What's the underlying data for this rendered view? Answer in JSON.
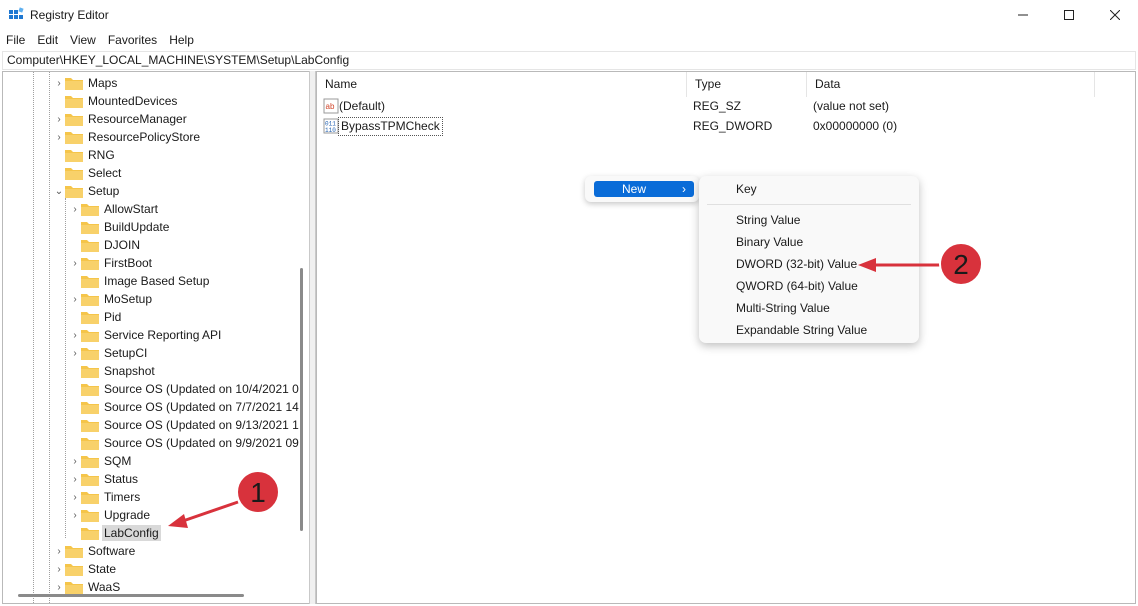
{
  "window": {
    "title": "Registry Editor"
  },
  "menu": [
    "File",
    "Edit",
    "View",
    "Favorites",
    "Help"
  ],
  "address": "Computer\\HKEY_LOCAL_MACHINE\\SYSTEM\\Setup\\LabConfig",
  "tree": {
    "items": [
      "Maps",
      "MountedDevices",
      "ResourceManager",
      "ResourcePolicyStore",
      "RNG",
      "Select",
      "Setup",
      "AllowStart",
      "BuildUpdate",
      "DJOIN",
      "FirstBoot",
      "Image Based Setup",
      "MoSetup",
      "Pid",
      "Service Reporting API",
      "SetupCI",
      "Snapshot",
      "Source OS (Updated on 10/4/2021 0",
      "Source OS (Updated on 7/7/2021 14",
      "Source OS (Updated on 9/13/2021 1",
      "Source OS (Updated on 9/9/2021 09",
      "SQM",
      "Status",
      "Timers",
      "Upgrade",
      "LabConfig",
      "Software",
      "State",
      "WaaS"
    ],
    "selected": "LabConfig"
  },
  "list": {
    "headers": {
      "name": "Name",
      "type": "Type",
      "data": "Data"
    },
    "rows": [
      {
        "name": "(Default)",
        "type": "REG_SZ",
        "data": "(value not set)",
        "icon": "string-value-icon"
      },
      {
        "name": "BypassTPMCheck",
        "type": "REG_DWORD",
        "data": "0x00000000 (0)",
        "icon": "binary-value-icon"
      }
    ]
  },
  "context_menu": {
    "new_label": "New",
    "submenu": [
      "Key",
      "String Value",
      "Binary Value",
      "DWORD (32-bit) Value",
      "QWORD (64-bit) Value",
      "Multi-String Value",
      "Expandable String Value"
    ]
  },
  "annotations": {
    "marker_1": "1",
    "marker_2": "2",
    "color": "#d8323c"
  },
  "colors": {
    "selection": "#0a6cd8",
    "folder": "#f5c54a"
  }
}
